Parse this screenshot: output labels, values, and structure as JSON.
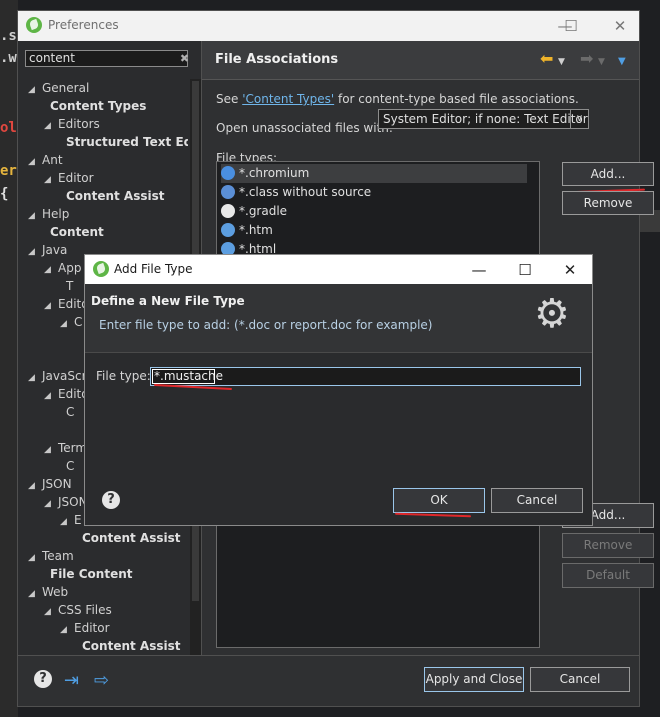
{
  "background_editor": {
    "lines": [
      {
        "text": ".st",
        "color": "#cfcfcf"
      },
      {
        "text": ".w",
        "color": "#cfcfcf"
      },
      {
        "text": "olle",
        "color": "#e0473f"
      },
      {
        "text": "er'",
        "color": "#e5b43e"
      },
      {
        "text": "{",
        "color": "#e0e0e0"
      }
    ]
  },
  "window": {
    "title": "Preferences",
    "minimize": "—",
    "maximize": "☐",
    "close": "✕"
  },
  "filter": {
    "value": "content",
    "clear_icon": "clear-icon"
  },
  "tree": [
    {
      "label": "General",
      "arrow": "◢",
      "level": 0,
      "bold": false
    },
    {
      "label": "Content Types",
      "arrow": "",
      "level": 1,
      "bold": true
    },
    {
      "label": "Editors",
      "arrow": "◢",
      "level": 1,
      "bold": false
    },
    {
      "label": "Structured Text Ed",
      "arrow": "",
      "level": 2,
      "bold": true
    },
    {
      "label": "Ant",
      "arrow": "◢",
      "level": 0,
      "bold": false
    },
    {
      "label": "Editor",
      "arrow": "◢",
      "level": 1,
      "bold": false
    },
    {
      "label": "Content Assist",
      "arrow": "",
      "level": 2,
      "bold": true
    },
    {
      "label": "Help",
      "arrow": "◢",
      "level": 0,
      "bold": false
    },
    {
      "label": "Content",
      "arrow": "",
      "level": 1,
      "bold": true
    },
    {
      "label": "Java",
      "arrow": "◢",
      "level": 0,
      "bold": false
    },
    {
      "label": "App",
      "arrow": "◢",
      "level": 1,
      "bold": false
    },
    {
      "label": "T",
      "arrow": "",
      "level": 2,
      "bold": false
    },
    {
      "label": "Edito",
      "arrow": "◢",
      "level": 1,
      "bold": false
    },
    {
      "label": "C",
      "arrow": "◢",
      "level": 2,
      "bold": false
    },
    {
      "label": "",
      "arrow": "",
      "level": 2,
      "bold": false
    },
    {
      "label": "",
      "arrow": "",
      "level": 2,
      "bold": false
    },
    {
      "label": "JavaScri",
      "arrow": "◢",
      "level": 0,
      "bold": false
    },
    {
      "label": "Edito",
      "arrow": "◢",
      "level": 1,
      "bold": false
    },
    {
      "label": "C",
      "arrow": "",
      "level": 2,
      "bold": false
    },
    {
      "label": "",
      "arrow": "",
      "level": 2,
      "bold": false
    },
    {
      "label": "Term",
      "arrow": "◢",
      "level": 1,
      "bold": false
    },
    {
      "label": "C",
      "arrow": "",
      "level": 2,
      "bold": false
    },
    {
      "label": "JSON",
      "arrow": "◢",
      "level": 0,
      "bold": false
    },
    {
      "label": "JSON",
      "arrow": "◢",
      "level": 1,
      "bold": false
    },
    {
      "label": "E",
      "arrow": "◢",
      "level": 2,
      "bold": false
    },
    {
      "label": "Content Assist",
      "arrow": "",
      "level": 3,
      "bold": true
    },
    {
      "label": "Team",
      "arrow": "◢",
      "level": 0,
      "bold": false
    },
    {
      "label": "File Content",
      "arrow": "",
      "level": 1,
      "bold": true
    },
    {
      "label": "Web",
      "arrow": "◢",
      "level": 0,
      "bold": false
    },
    {
      "label": "CSS Files",
      "arrow": "◢",
      "level": 1,
      "bold": false
    },
    {
      "label": "Editor",
      "arrow": "◢",
      "level": 2,
      "bold": false
    },
    {
      "label": "Content Assist",
      "arrow": "",
      "level": 3,
      "bold": true
    }
  ],
  "page": {
    "title": "File Associations",
    "desc_prefix": "See ",
    "desc_link": "'Content Types'",
    "desc_suffix": " for content-type based file associations.",
    "open_label": "Open unassociated files with:",
    "open_value": "System Editor; if none: Text Editor",
    "file_types_label": "File types:",
    "file_types": [
      {
        "name": "*.chromium",
        "icon": "chromium-icon",
        "color": "#4a8fe0",
        "selected": true
      },
      {
        "name": "*.class without source",
        "icon": "java-class-icon",
        "color": "#5b8fd6",
        "selected": false
      },
      {
        "name": "*.gradle",
        "icon": "file-icon",
        "color": "#e8e8e8",
        "selected": false
      },
      {
        "name": "*.htm",
        "icon": "globe-icon",
        "color": "#5c9ee0",
        "selected": false
      },
      {
        "name": "*.html",
        "icon": "globe-icon",
        "color": "#5c9ee0",
        "selected": false
      }
    ],
    "add_button": "Add...",
    "remove_button": "Remove",
    "add2_button": "Add...",
    "remove2_button": "Remove",
    "default_button": "Default"
  },
  "footer": {
    "help_icon": "?",
    "import_icon": "⇥",
    "export_icon": "⇨",
    "apply_close": "Apply and Close",
    "cancel": "Cancel"
  },
  "dialog": {
    "title": "Add File Type",
    "minimize": "—",
    "maximize": "☐",
    "close": "✕",
    "heading": "Define a New File Type",
    "subheading": "Enter file type to add: (*.doc or report.doc for example)",
    "field_label": "File type:",
    "field_value": "*.mustache",
    "help_icon": "?",
    "ok": "OK",
    "cancel": "Cancel"
  },
  "colors": {
    "accent_link": "#6fb5ea",
    "annotation_red": "#e0282b",
    "nav_arrow_yellow": "#f0b42a",
    "nav_arrow_blue": "#4f9ee3"
  }
}
